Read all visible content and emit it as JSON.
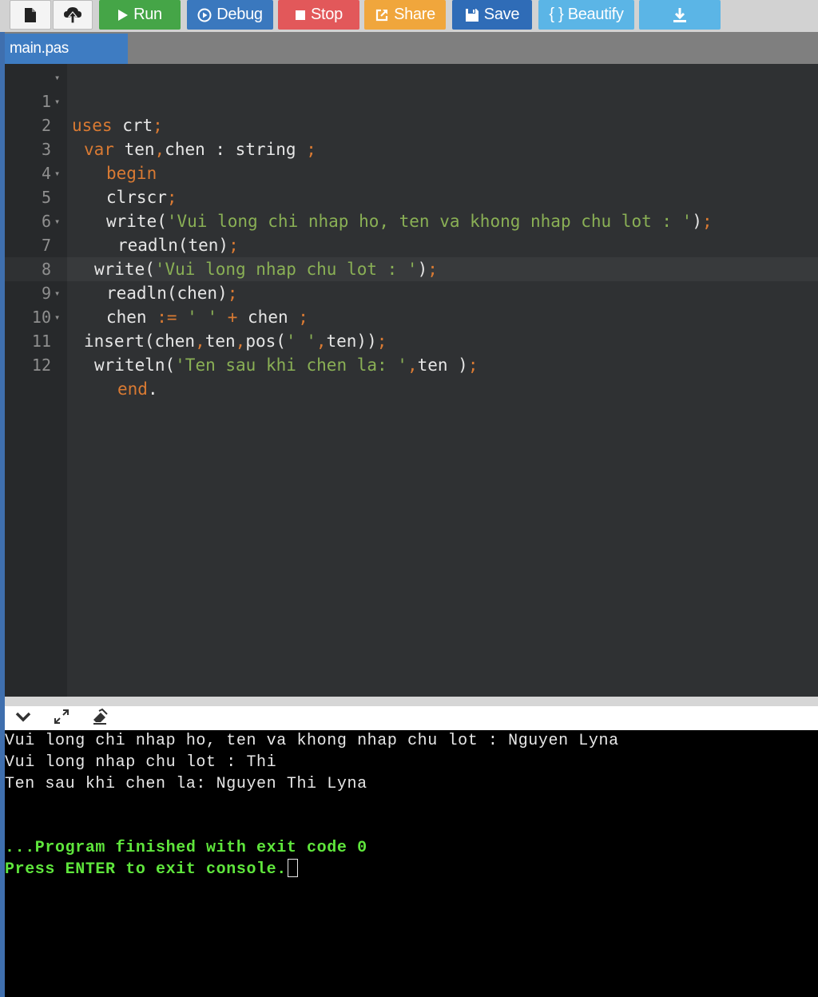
{
  "toolbar": {
    "run": "Run",
    "debug": "Debug",
    "stop": "Stop",
    "share": "Share",
    "save": "Save",
    "beautify": "{ } Beautify",
    "icons": [
      "new-file-icon",
      "upload-icon",
      "play-icon",
      "debug-icon",
      "stop-icon",
      "share-icon",
      "save-icon",
      "download-icon"
    ],
    "colors": {
      "run": "#45a547",
      "debug": "#3a78be",
      "stop": "#e2585a",
      "share": "#f0a63c",
      "save": "#2f6cb7",
      "beautify": "#5bb5e6"
    }
  },
  "tabs": [
    {
      "label": "main.pas"
    }
  ],
  "editor": {
    "lines": [
      {
        "n": "1",
        "fold": true
      },
      {
        "n": "2",
        "fold": true
      },
      {
        "n": "3",
        "fold": false
      },
      {
        "n": "4",
        "fold": false
      },
      {
        "n": "5",
        "fold": true
      },
      {
        "n": "6",
        "fold": false
      },
      {
        "n": "7",
        "fold": true
      },
      {
        "n": "8",
        "fold": false
      },
      {
        "n": "9",
        "fold": false
      },
      {
        "n": "10",
        "fold": true
      },
      {
        "n": "11",
        "fold": true
      },
      {
        "n": "12",
        "fold": false
      }
    ],
    "code": {
      "l1": {
        "kw": "uses",
        "rest": " crt",
        "semi": ";"
      },
      "l2": {
        "kw": "var",
        "rest": " ten",
        "comma": ",",
        "rest2": "chen : string ",
        "semi": ";"
      },
      "l3": {
        "kw": "begin"
      },
      "l4": {
        "rest": "clrscr",
        "semi": ";"
      },
      "l5": {
        "rest": "write(",
        "str": "'Vui long chi nhap ho, ten va khong nhap chu lot : '",
        "close": ")",
        "semi": ";"
      },
      "l6": {
        "rest": "readln(ten)",
        "semi": ";"
      },
      "l7": {
        "rest": "write(",
        "str": "'Vui long nhap chu lot : '",
        "close": ")",
        "semi": ";"
      },
      "l8": {
        "rest": "readln(chen)",
        "semi": ";"
      },
      "l9": {
        "rest": "chen ",
        "op": ":=",
        "str": " ' ' ",
        "plus": "+",
        "rest2": " chen ",
        "semi": ";"
      },
      "l10": {
        "rest": "insert(chen",
        "c1": ",",
        "rest2": "ten",
        "c2": ",",
        "rest3": "pos(",
        "str": "' '",
        "c3": ",",
        "rest4": "ten))",
        "semi": ";"
      },
      "l11": {
        "rest": "writeln(",
        "str": "'Ten sau khi chen la: '",
        "c1": ",",
        "rest2": "ten )",
        "semi": ";"
      },
      "l12": {
        "kw": "end",
        "dot": "."
      }
    }
  },
  "console": {
    "lines": [
      "Vui long chi nhap ho, ten va khong nhap chu lot : Nguyen Lyna",
      "Vui long nhap chu lot : Thi",
      "Ten sau khi chen la: Nguyen Thi Lyna"
    ],
    "finished": "...Program finished with exit code 0",
    "press": "Press ENTER to exit console."
  }
}
